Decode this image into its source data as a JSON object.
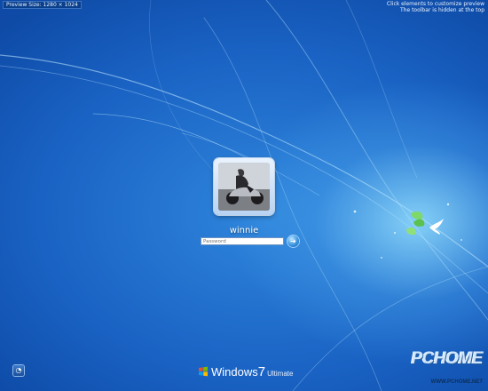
{
  "top_bar": {
    "preview_size": "Preview Size: 1280 × 1024",
    "hint_line1": "Click elements to customize preview",
    "hint_line2": "The toolbar is hidden at the top"
  },
  "login": {
    "username": "winnie",
    "password_placeholder": "Password",
    "submit_icon": "arrow-right-icon"
  },
  "footer": {
    "ease_of_access_icon": "ease-of-access-icon",
    "brand_windows": "Windows",
    "brand_version": "7",
    "brand_edition": "Ultimate"
  },
  "watermark": {
    "logo_text": "PCHOME",
    "url": "WWW.PCHOME.NET"
  },
  "colors": {
    "background": "#1a63c4",
    "glow": "#96e1ff",
    "text": "#ffffff"
  }
}
